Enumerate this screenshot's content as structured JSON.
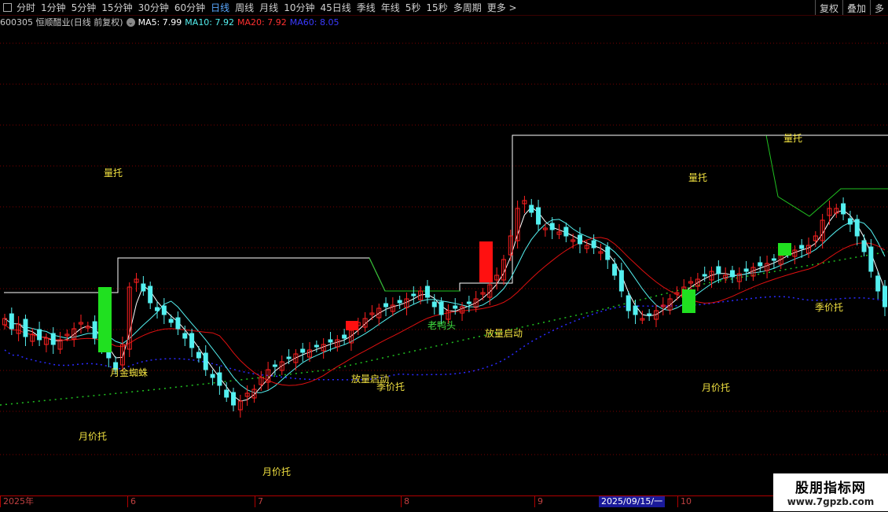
{
  "toolbar": {
    "periods": [
      "分时",
      "1分钟",
      "5分钟",
      "15分钟",
      "30分钟",
      "60分钟",
      "日线",
      "周线",
      "月线",
      "10分钟",
      "45日线",
      "季线",
      "年线",
      "5秒",
      "15秒",
      "多周期",
      "更多 >"
    ],
    "active": "日线",
    "right_buttons": [
      "复权",
      "叠加",
      "多"
    ]
  },
  "info": {
    "code_title": "600305 恒顺醋业(日线 前复权)",
    "ma5": "MA5: 7.99",
    "ma10": "MA10: 7.92",
    "ma20": "MA20: 7.92",
    "ma60": "MA60: 8.05"
  },
  "colors": {
    "up": "#ff2020",
    "down": "#54f0f0",
    "ma5": "#ffffff",
    "ma10": "#54f0f0",
    "ma20": "#ff2020",
    "ma60": "#2a2aff",
    "yellow_label": "#f0e040",
    "green_label": "#40e040",
    "grid": "#7a0000"
  },
  "annotations": [
    {
      "id": "lt1",
      "text": "量托",
      "color": "yellow"
    },
    {
      "id": "lt2",
      "text": "量托",
      "color": "yellow"
    },
    {
      "id": "lt3",
      "text": "量托",
      "color": "yellow"
    },
    {
      "id": "yzz",
      "text": "月金蜘蛛",
      "color": "yellow"
    },
    {
      "id": "yjt1",
      "text": "月价托",
      "color": "yellow"
    },
    {
      "id": "yjt2",
      "text": "月价托",
      "color": "yellow"
    },
    {
      "id": "yjt3",
      "text": "月价托",
      "color": "yellow"
    },
    {
      "id": "jjt1",
      "text": "季价托",
      "color": "yellow"
    },
    {
      "id": "jjt2",
      "text": "季价托",
      "color": "yellow"
    },
    {
      "id": "flqd1",
      "text": "放量启动",
      "color": "yellow"
    },
    {
      "id": "flqd2",
      "text": "放量启动",
      "color": "yellow"
    },
    {
      "id": "lyt",
      "text": "老鸭头",
      "color": "green"
    }
  ],
  "xaxis": {
    "year": "2025年",
    "months": [
      "6",
      "7",
      "8",
      "9",
      "10"
    ],
    "cursor_date": "2025/09/15/一"
  },
  "watermark": {
    "title": "股朋指标网",
    "url": "www.7gpzb.com"
  }
}
